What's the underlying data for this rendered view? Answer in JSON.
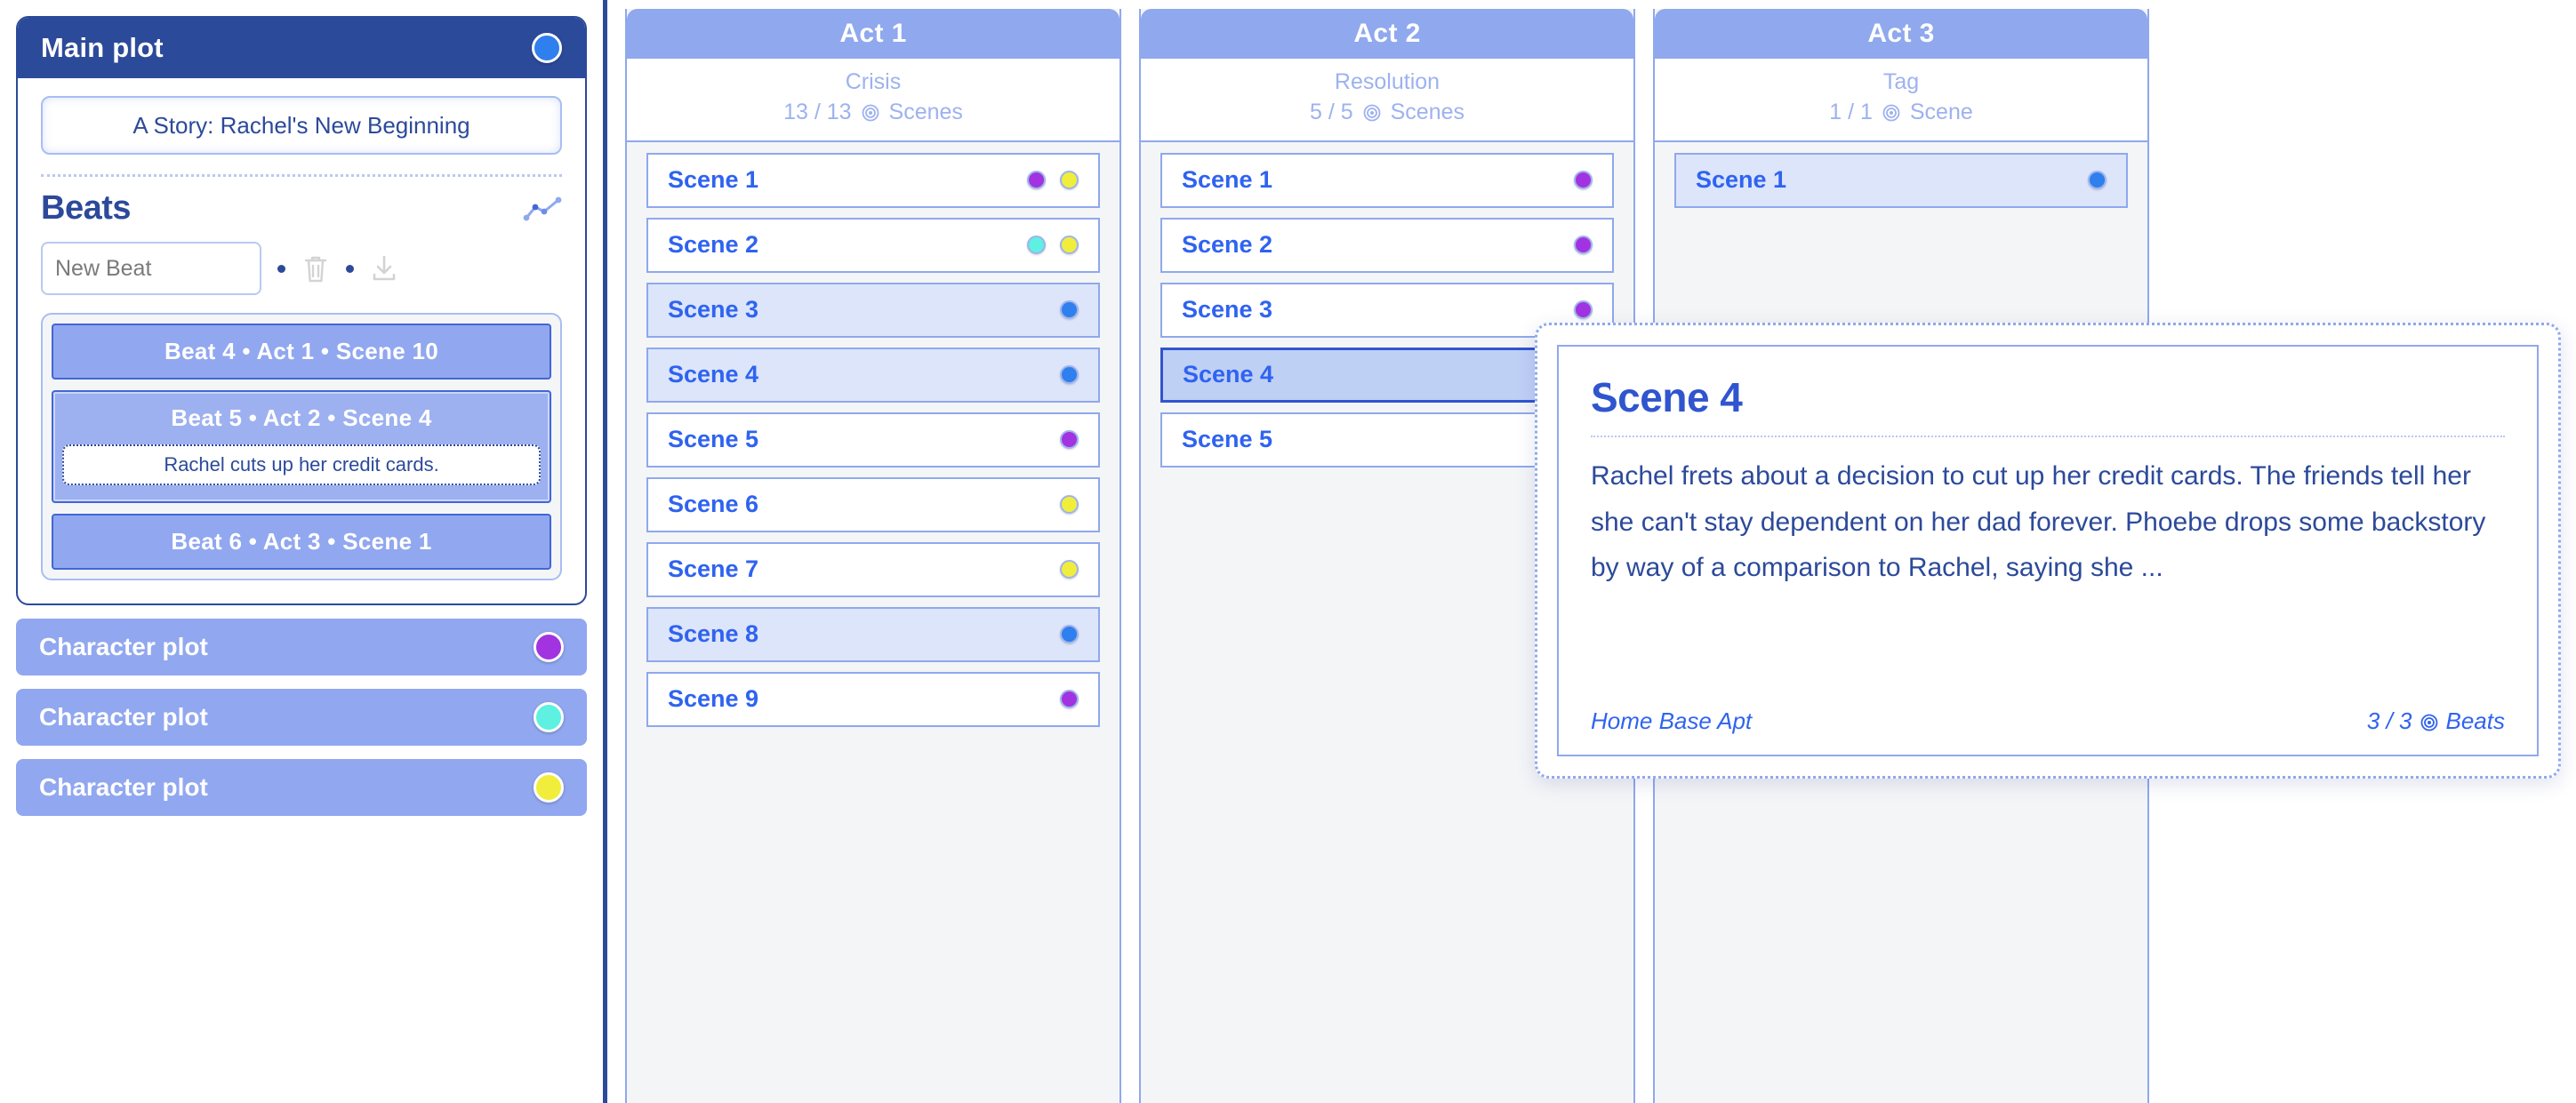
{
  "colors": {
    "brand_dark": "#2c4a9a",
    "brand_blue": "#2f63f0",
    "act_header": "#8fa8ee",
    "plot_row": "#91a7ef",
    "dot_blue": "#2f7fee",
    "dot_purple": "#a233e0",
    "dot_yellow": "#f0ee3a",
    "dot_cyan": "#5ef0e0",
    "highlight": "#dce5fa",
    "active": "#bfd0f5"
  },
  "sidebar": {
    "main_plot": {
      "title": "Main plot",
      "swatch_color": "#2f7fee",
      "swatch_icon": "color-swatch-icon",
      "story_title_value": "A Story: Rachel's New Beginning",
      "story_title_placeholder": "Story title",
      "beats_heading": "Beats",
      "chart_icon": "line-chart-icon",
      "new_beat_placeholder": "New Beat",
      "new_beat_value": "",
      "trash_icon": "trash-icon",
      "download_icon": "download-icon",
      "beats": [
        {
          "label": "Beat 4  •  Act 1  •  Scene 10",
          "selected": false,
          "note": ""
        },
        {
          "label": "Beat 5  •  Act 2  •  Scene 4",
          "selected": true,
          "note": "Rachel cuts up her credit cards."
        },
        {
          "label": "Beat 6  •  Act 3  •  Scene 1",
          "selected": false,
          "note": ""
        }
      ]
    },
    "character_plots": [
      {
        "label": "Character plot",
        "swatch_color": "#a233e0"
      },
      {
        "label": "Character plot",
        "swatch_color": "#5ef0e0"
      },
      {
        "label": "Character plot",
        "swatch_color": "#f0ee3a"
      }
    ]
  },
  "board": {
    "acts": [
      {
        "title": "Act 1",
        "type": "Crisis",
        "count": "13 / 13",
        "count_unit": "Scenes",
        "target_icon": "target-icon",
        "scenes": [
          {
            "label": "Scene 1",
            "state": "normal",
            "dots": [
              "#a233e0",
              "#f0ee3a"
            ]
          },
          {
            "label": "Scene 2",
            "state": "normal",
            "dots": [
              "#5ef0e0",
              "#f0ee3a"
            ]
          },
          {
            "label": "Scene 3",
            "state": "highlight",
            "dots": [
              "#2f7fee"
            ]
          },
          {
            "label": "Scene 4",
            "state": "highlight",
            "dots": [
              "#2f7fee"
            ]
          },
          {
            "label": "Scene 5",
            "state": "normal",
            "dots": [
              "#a233e0"
            ]
          },
          {
            "label": "Scene 6",
            "state": "normal",
            "dots": [
              "#f0ee3a"
            ]
          },
          {
            "label": "Scene 7",
            "state": "normal",
            "dots": [
              "#f0ee3a"
            ]
          },
          {
            "label": "Scene 8",
            "state": "highlight",
            "dots": [
              "#2f7fee"
            ]
          },
          {
            "label": "Scene 9",
            "state": "normal",
            "dots": [
              "#a233e0"
            ]
          }
        ]
      },
      {
        "title": "Act 2",
        "type": "Resolution",
        "count": "5 / 5",
        "count_unit": "Scenes",
        "target_icon": "target-icon",
        "scenes": [
          {
            "label": "Scene 1",
            "state": "normal",
            "dots": [
              "#a233e0"
            ]
          },
          {
            "label": "Scene 2",
            "state": "normal",
            "dots": [
              "#a233e0"
            ]
          },
          {
            "label": "Scene 3",
            "state": "normal",
            "dots": [
              "#a233e0"
            ]
          },
          {
            "label": "Scene 4",
            "state": "active",
            "dots": [
              "#2f7fee",
              "#f0ee3a"
            ]
          },
          {
            "label": "Scene 5",
            "state": "normal",
            "dots": [
              "#5ef0e0"
            ]
          }
        ]
      },
      {
        "title": "Act 3",
        "type": "Tag",
        "count": "1 / 1",
        "count_unit": "Scene",
        "target_icon": "target-icon",
        "scenes": [
          {
            "label": "Scene 1",
            "state": "highlight",
            "dots": [
              "#2f7fee"
            ]
          }
        ]
      }
    ]
  },
  "popup": {
    "title": "Scene 4",
    "body": "Rachel frets about a decision to cut up her credit cards. The friends tell her she can't stay dependent on her dad forever. Phoebe drops some backstory by way of a comparison to Rachel, saying she ...",
    "location": "Home Base Apt",
    "beats_count": "3 / 3",
    "beats_label": "Beats",
    "target_icon": "target-icon"
  }
}
